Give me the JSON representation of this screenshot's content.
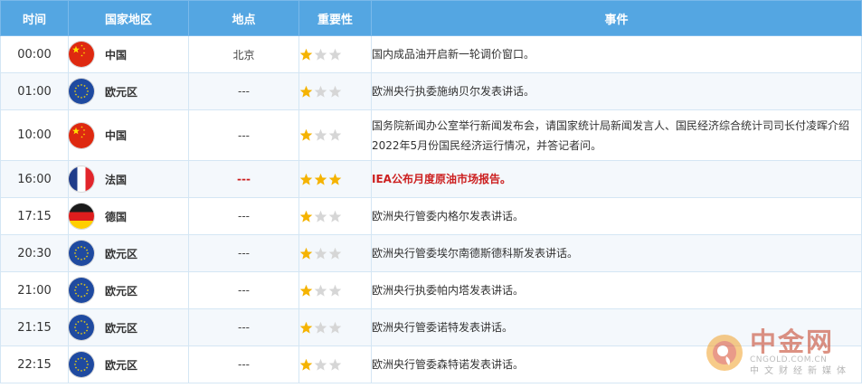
{
  "colors": {
    "header_bg": "#54a6e2",
    "header_text": "#ffffff",
    "star_on": "#f5b301",
    "star_off": "#d6d6d6",
    "highlight_text": "#cc1f1f",
    "row_alt": "#f4f8fc"
  },
  "table": {
    "headers": {
      "time": "时间",
      "country": "国家地区",
      "place": "地点",
      "importance": "重要性",
      "event": "事件"
    },
    "rows": [
      {
        "time": "00:00",
        "country": "中国",
        "flag_icon": "china-flag-icon",
        "place": "北京",
        "stars": 1,
        "event": "国内成品油开启新一轮调价窗口。",
        "highlight": false
      },
      {
        "time": "01:00",
        "country": "欧元区",
        "flag_icon": "eu-flag-icon",
        "place": "---",
        "stars": 1,
        "event": "欧洲央行执委施纳贝尔发表讲话。",
        "highlight": false
      },
      {
        "time": "10:00",
        "country": "中国",
        "flag_icon": "china-flag-icon",
        "place": "---",
        "stars": 1,
        "event": "国务院新闻办公室举行新闻发布会，请国家统计局新闻发言人、国民经济综合统计司司长付凌晖介绍2022年5月份国民经济运行情况，并答记者问。",
        "highlight": false
      },
      {
        "time": "16:00",
        "country": "法国",
        "flag_icon": "france-flag-icon",
        "place": "---",
        "stars": 3,
        "event": "IEA公布月度原油市场报告。",
        "highlight": true
      },
      {
        "time": "17:15",
        "country": "德国",
        "flag_icon": "germany-flag-icon",
        "place": "---",
        "stars": 1,
        "event": "欧洲央行管委内格尔发表讲话。",
        "highlight": false
      },
      {
        "time": "20:30",
        "country": "欧元区",
        "flag_icon": "eu-flag-icon",
        "place": "---",
        "stars": 1,
        "event": "欧洲央行管委埃尔南德斯德科斯发表讲话。",
        "highlight": false
      },
      {
        "time": "21:00",
        "country": "欧元区",
        "flag_icon": "eu-flag-icon",
        "place": "---",
        "stars": 1,
        "event": "欧洲央行执委帕内塔发表讲话。",
        "highlight": false
      },
      {
        "time": "21:15",
        "country": "欧元区",
        "flag_icon": "eu-flag-icon",
        "place": "---",
        "stars": 1,
        "event": "欧洲央行管委诺特发表讲话。",
        "highlight": false
      },
      {
        "time": "22:15",
        "country": "欧元区",
        "flag_icon": "eu-flag-icon",
        "place": "---",
        "stars": 1,
        "event": "欧洲央行管委森特诺发表讲话。",
        "highlight": false
      }
    ]
  },
  "watermark": {
    "name": "中金网",
    "url": "CNGOLD.COM.CN",
    "tagline": "中文财经新媒体"
  }
}
